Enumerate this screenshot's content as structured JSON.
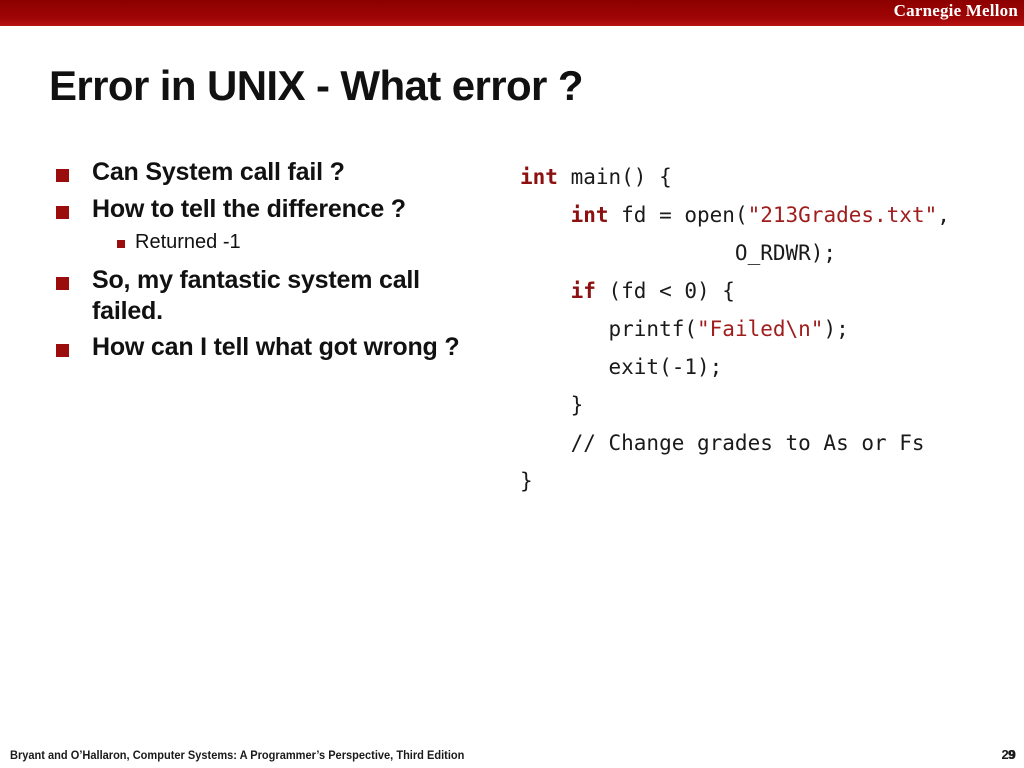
{
  "banner": {
    "brand": "Carnegie Mellon",
    "color": "#9b0000"
  },
  "title": "Error in UNIX - What error ?",
  "bullets": [
    {
      "level": 1,
      "text": "Can System call fail ?"
    },
    {
      "level": 1,
      "text": "How to tell the difference ?"
    },
    {
      "level": 2,
      "text": "Returned -1"
    },
    {
      "level": 1,
      "text": "So, my fantastic system call failed."
    },
    {
      "level": 1,
      "text": "How can I tell what got wrong ?"
    }
  ],
  "code": {
    "accent_keyword_color": "#8c1010",
    "accent_string_color": "#a01d1d",
    "lines": [
      {
        "segments": [
          {
            "t": "int",
            "c": "kw"
          },
          {
            "t": " main() {",
            "c": ""
          }
        ]
      },
      {
        "segments": [
          {
            "t": "    ",
            "c": ""
          },
          {
            "t": "int",
            "c": "kw"
          },
          {
            "t": " fd = open(",
            "c": ""
          },
          {
            "t": "\"213Grades.txt\"",
            "c": "str"
          },
          {
            "t": ",",
            "c": ""
          }
        ]
      },
      {
        "segments": [
          {
            "t": "                 O_RDWR);",
            "c": ""
          }
        ]
      },
      {
        "segments": [
          {
            "t": "    ",
            "c": ""
          },
          {
            "t": "if",
            "c": "kw"
          },
          {
            "t": " (fd < 0) {",
            "c": ""
          }
        ]
      },
      {
        "segments": [
          {
            "t": "       printf(",
            "c": ""
          },
          {
            "t": "\"Failed\\n\"",
            "c": "str"
          },
          {
            "t": ");",
            "c": ""
          }
        ]
      },
      {
        "segments": [
          {
            "t": "       exit(-1);",
            "c": ""
          }
        ]
      },
      {
        "segments": [
          {
            "t": "    }",
            "c": ""
          }
        ]
      },
      {
        "segments": [
          {
            "t": "    // Change grades to As or Fs",
            "c": "cmt"
          }
        ]
      },
      {
        "segments": [
          {
            "t": "}",
            "c": ""
          }
        ]
      }
    ]
  },
  "footer": {
    "attribution": "Bryant and O’Hallaron, Computer Systems: A Programmer’s Perspective, Third Edition",
    "page_number": "29",
    "page_number_overlay": "9"
  }
}
